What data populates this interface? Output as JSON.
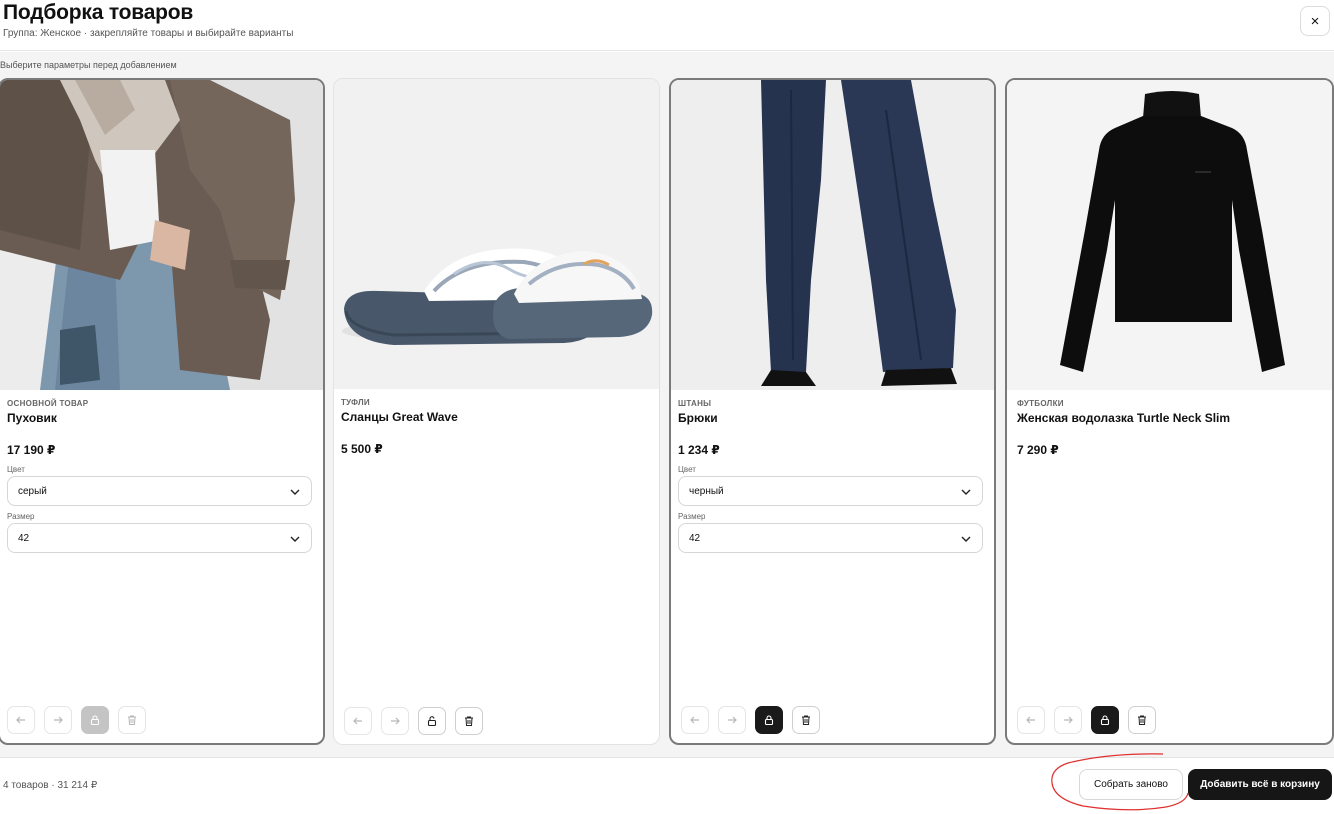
{
  "header": {
    "title": "Подборка товаров",
    "subtitle": "Группа: Женское · закрепляйте товары и выбирайте варианты",
    "close_label": "×"
  },
  "hint": "Выберите параметры перед добавлением",
  "cards": [
    {
      "category": "ОСНОВНОЙ ТОВАР",
      "name": "Пуховик",
      "price": "17 190 ₽",
      "fields": [
        {
          "label": "Цвет",
          "value": "серый"
        },
        {
          "label": "Размер",
          "value": "42"
        }
      ],
      "pinned": true
    },
    {
      "category": "ТУФЛИ",
      "name": "Сланцы Great Wave",
      "price": "5 500 ₽",
      "pinned": false
    },
    {
      "category": "ШТАНЫ",
      "name": "Брюки",
      "price": "1 234 ₽",
      "fields": [
        {
          "label": "Цвет",
          "value": "черный"
        },
        {
          "label": "Размер",
          "value": "42"
        }
      ],
      "pinned": true
    },
    {
      "category": "ФУТБОЛКИ",
      "name": "Женская водолазка Turtle Neck Slim",
      "price": "7 290 ₽",
      "pinned": true
    }
  ],
  "footer": {
    "summary": "4 товаров · 31 214 ₽",
    "rebuild_label": "Собрать заново",
    "add_all_label": "Добавить всё в корзину"
  },
  "colors": {
    "primary": "#161616",
    "annotation": "#e03030",
    "pinned_disabled": "#c4c4c4"
  }
}
